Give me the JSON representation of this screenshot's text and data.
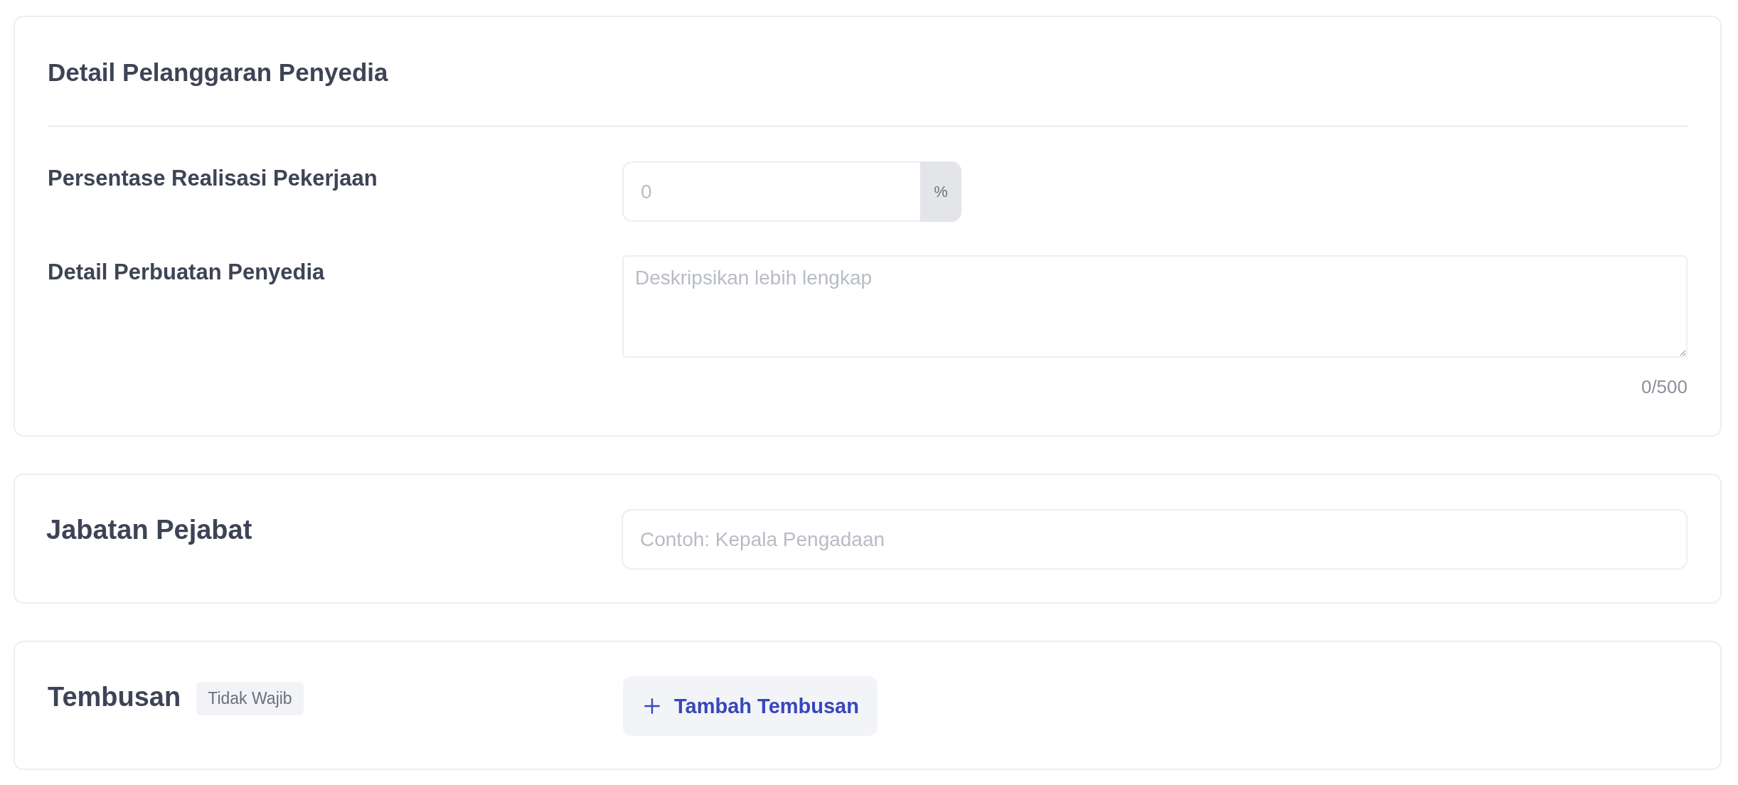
{
  "sections": [
    {
      "kind": "detail",
      "title": "Detail Pelanggaran Penyedia",
      "fields": [
        {
          "kind": "number",
          "label": "Persentase Realisasi Pekerjaan",
          "placeholder": "0",
          "suffix": "%"
        },
        {
          "kind": "textarea",
          "label": "Detail Perbuatan Penyedia",
          "placeholder": "Deskripsikan lebih lengkap",
          "counter": "0/500"
        }
      ]
    },
    {
      "kind": "input",
      "title": "Jabatan Pejabat",
      "placeholder": "Contoh: Kepala Pengadaan"
    },
    {
      "kind": "action",
      "title": "Tembusan",
      "badge": "Tidak Wajib",
      "button": "Tambah Tembusan"
    }
  ]
}
